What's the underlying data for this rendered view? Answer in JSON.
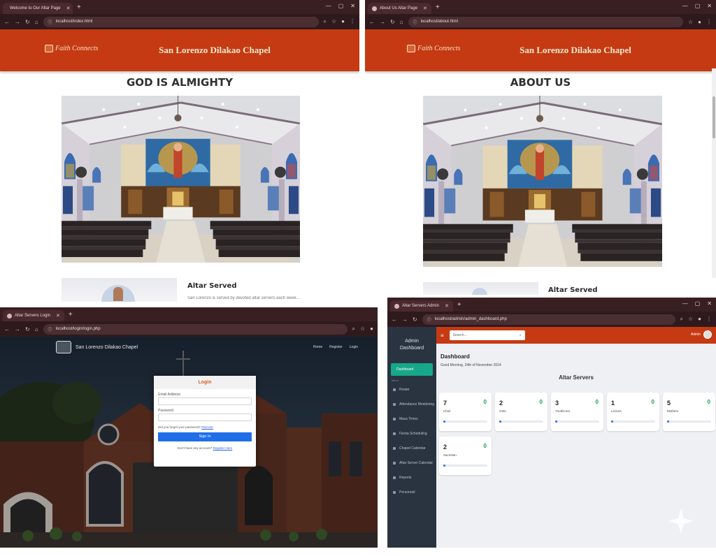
{
  "browser": {
    "tab_title_1": "Welcome to Our Altar Page",
    "tab_title_2": "About Us Altar Page",
    "tab_title_3": "Altar Servers Login",
    "tab_title_4": "Altar Servers Admin",
    "url_1": "localhost/index.html",
    "url_2": "localhost/about.html",
    "url_3": "localhost/login/login.php",
    "url_4": "localhost/admin/admin_dashboard.php"
  },
  "site": {
    "logo_text": "Faith Connects",
    "title": "San Lorenzo Dilakao Chapel"
  },
  "home": {
    "heading": "GOD IS ALMIGHTY",
    "card_title": "Altar Served",
    "card_text": "San Lorenzo is served by devoted altar servers each week..."
  },
  "about": {
    "heading": "ABOUT US",
    "card_title": "Altar Served"
  },
  "login": {
    "brand": "San Lorenzo Dilakao Chapel",
    "nav": [
      "Home",
      "Register",
      "Login"
    ],
    "box_title": "Login",
    "email_label": "Email Address",
    "password_label": "Password",
    "forgot_text": "Did you forget your password?",
    "forgot_link": "Recover",
    "button": "Sign In",
    "no_account_text": "Don't have any account?",
    "register_link": "Register Here"
  },
  "admin": {
    "brand": "Admin Dashboard",
    "dashboard_item": "Dashboard",
    "section": "Menu",
    "side_items": [
      "Roster",
      "Attendance Monitoring",
      "Mass Times",
      "Fiesta Scheduling",
      "Chapel Calendar",
      "Altar Server Calendar",
      "Reports",
      "Personnel"
    ],
    "search_placeholder": "Search...",
    "user": "Admin",
    "title": "Dashboard",
    "date": "Good Morning, 24th of November 2024",
    "section_title": "Altar Servers",
    "stats": [
      {
        "count": "7",
        "name": "Choir",
        "badge": "0",
        "progress": 0.05
      },
      {
        "count": "2",
        "name": "CWL",
        "badge": "0",
        "progress": 0.05
      },
      {
        "count": "3",
        "name": "YouthCore",
        "badge": "0",
        "progress": 0.05
      },
      {
        "count": "1",
        "name": "Lectors",
        "badge": "0",
        "progress": 0.05
      },
      {
        "count": "5",
        "name": "Mothers",
        "badge": "0",
        "progress": 0.05
      },
      {
        "count": "2",
        "name": "Sacristan",
        "badge": "0",
        "progress": 0.05
      }
    ]
  }
}
